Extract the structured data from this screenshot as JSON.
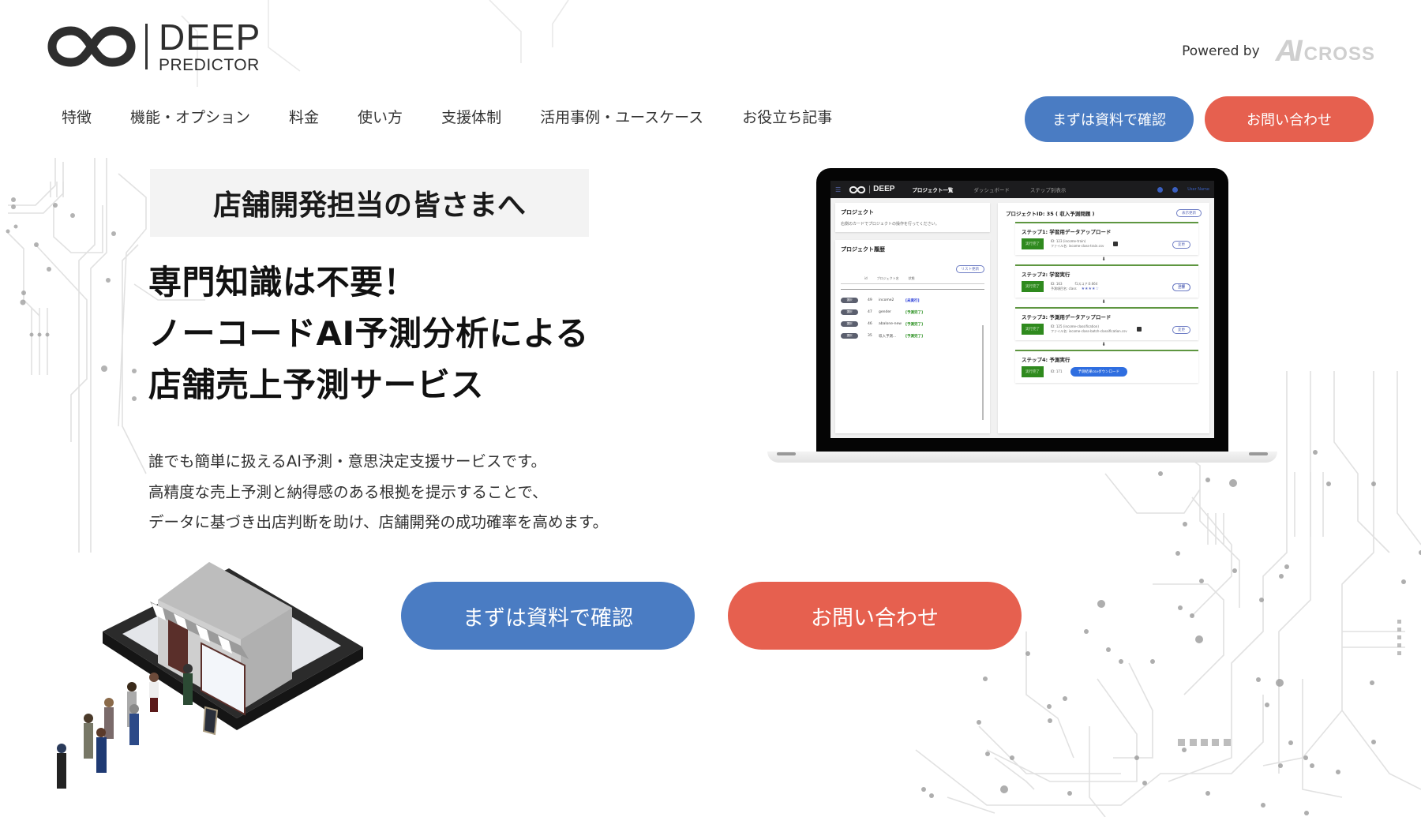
{
  "brand": {
    "logo_line1": "DEEP",
    "logo_line2": "PREDICTOR",
    "powered_by": "Powered by",
    "partner_ai": "AI",
    "partner_cross": "CROSS"
  },
  "nav": {
    "items": [
      {
        "label": "特徴"
      },
      {
        "label": "機能・オプション"
      },
      {
        "label": "料金"
      },
      {
        "label": "使い方"
      },
      {
        "label": "支援体制"
      },
      {
        "label": "活用事例・ユースケース"
      },
      {
        "label": "お役立ち記事"
      }
    ]
  },
  "header_buttons": {
    "docs": "まずは資料で確認",
    "contact": "お問い合わせ"
  },
  "hero": {
    "tagline": "店舗開発担当の皆さまへ",
    "headline": [
      "専門知識は不要！",
      "ノーコードAI予測分析による",
      "店舗売上予測サービス"
    ],
    "description": [
      "誰でも簡単に扱えるAI予測・意思決定支援サービスです。",
      "高精度な売上予測と納得感のある根拠を提示することで、",
      "データに基づき出店判断を助け、店舗開発の成功確率を高めます。"
    ],
    "cta_docs": "まずは資料で確認",
    "cta_contact": "お問い合わせ"
  },
  "app_screenshot": {
    "nav_logo": "DEEP",
    "tabs": [
      "プロジェクト一覧",
      "ダッシュボード",
      "ステップ別表示"
    ],
    "user": "User Name",
    "project_card": {
      "title": "プロジェクト",
      "hint": "右側のカードでプロジェクトの操作を行ってください。"
    },
    "history": {
      "title": "プロジェクト履歴",
      "refresh": "リスト更新",
      "columns": [
        "id",
        "プロジェクト名",
        "状態"
      ],
      "select_label": "選択",
      "rows": [
        {
          "id": "49",
          "name": "income2",
          "status": "[未実行]",
          "status_type": "pending"
        },
        {
          "id": "47",
          "name": "gender",
          "status": "[予測完了]",
          "status_type": "done"
        },
        {
          "id": "46",
          "name": "abalone-new",
          "status": "[予測完了]",
          "status_type": "done"
        },
        {
          "id": "35",
          "name": "収入予測...",
          "status": "[予測完了]",
          "status_type": "done"
        }
      ]
    },
    "project_detail": {
      "title": "プロジェクトID: 35 ( 収入予測問題 )",
      "refresh": "表示更新",
      "steps": [
        {
          "title": "ステップ1: 学習用データアップロード",
          "badge": "実行完了",
          "meta1": "ID: 123 (income-train)",
          "meta2": "ファイル名: income-class-train.csv",
          "action": "変更"
        },
        {
          "title": "ステップ2: 学習実行",
          "badge": "実行完了",
          "meta1": "ID: 163　　　　f1スコア:0.664",
          "meta2": "予測項目名: class",
          "action": "上書",
          "stars": "★★★★☆",
          "detail": "詳細"
        },
        {
          "title": "ステップ3: 予測用データアップロード",
          "badge": "実行完了",
          "meta1": "ID: 125 (income-classification)",
          "meta2": "ファイル名: income-class-batch-classification.csv",
          "action": "変更"
        },
        {
          "title": "ステップ4: 予測実行",
          "badge": "実行完了",
          "meta1": "ID: 171",
          "download": "予測結果csvダウンロード"
        }
      ]
    }
  },
  "colors": {
    "blue_button": "#4a7cc3",
    "red_button": "#e6604f",
    "step_green": "#2f8a1e"
  }
}
